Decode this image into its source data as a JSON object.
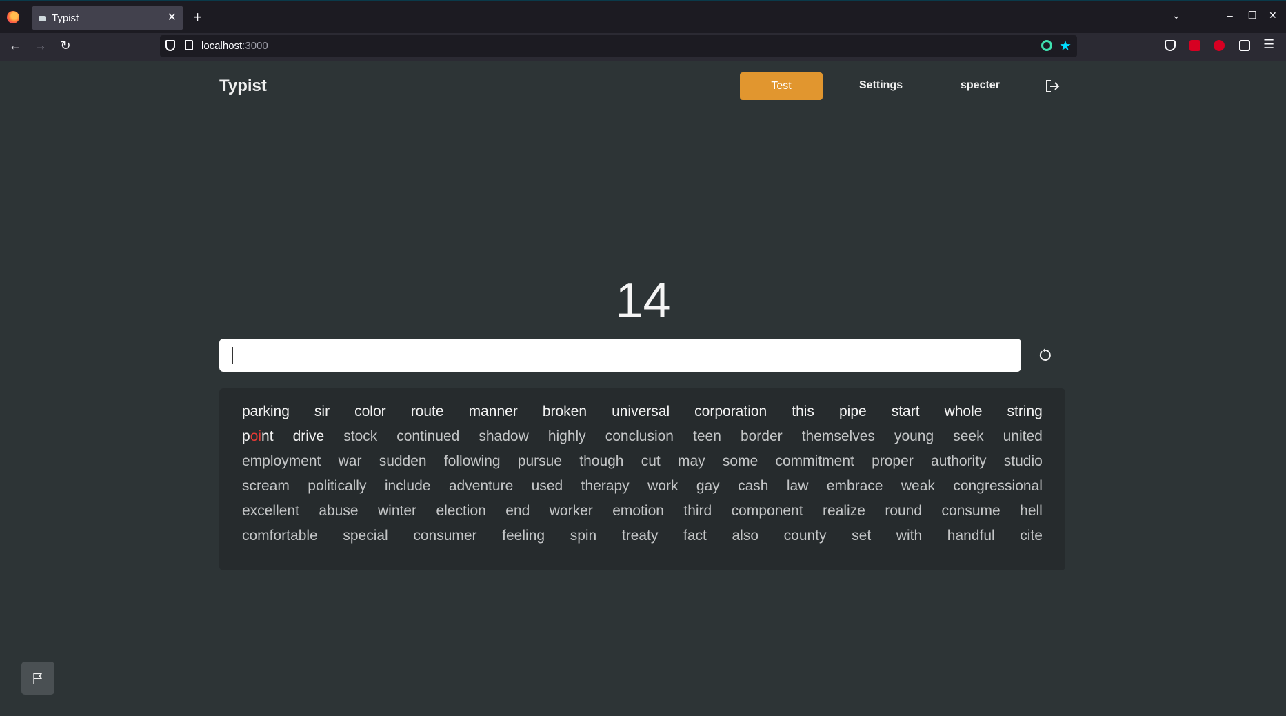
{
  "browser": {
    "tab_title": "Typist",
    "url_host": "localhost",
    "url_port": ":3000"
  },
  "header": {
    "brand": "Typist",
    "nav": {
      "test": "Test",
      "settings": "Settings",
      "user": "specter"
    }
  },
  "timer": "14",
  "input": {
    "value": ""
  },
  "words": {
    "rows": [
      [
        "parking",
        "sir",
        "color",
        "route",
        "manner",
        "broken",
        "universal",
        "corporation",
        "this",
        "pipe",
        "start",
        "whole",
        "string"
      ],
      [
        "point",
        "drive",
        "stock",
        "continued",
        "shadow",
        "highly",
        "conclusion",
        "teen",
        "border",
        "themselves",
        "young",
        "seek",
        "united"
      ],
      [
        "employment",
        "war",
        "sudden",
        "following",
        "pursue",
        "though",
        "cut",
        "may",
        "some",
        "commitment",
        "proper",
        "authority",
        "studio"
      ],
      [
        "scream",
        "politically",
        "include",
        "adventure",
        "used",
        "therapy",
        "work",
        "gay",
        "cash",
        "law",
        "embrace",
        "weak",
        "congressional"
      ],
      [
        "excellent",
        "abuse",
        "winter",
        "election",
        "end",
        "worker",
        "emotion",
        "third",
        "component",
        "realize",
        "round",
        "consume",
        "hell"
      ],
      [
        "comfortable",
        "special",
        "consumer",
        "feeling",
        "spin",
        "treaty",
        "fact",
        "also",
        "county",
        "set",
        "with",
        "handful",
        "cite"
      ]
    ],
    "current_word": {
      "before": "p",
      "error": "oi",
      "after": "nt"
    }
  },
  "colors": {
    "background": "#2d3436",
    "accent": "#e1962f",
    "error": "#e53935"
  }
}
